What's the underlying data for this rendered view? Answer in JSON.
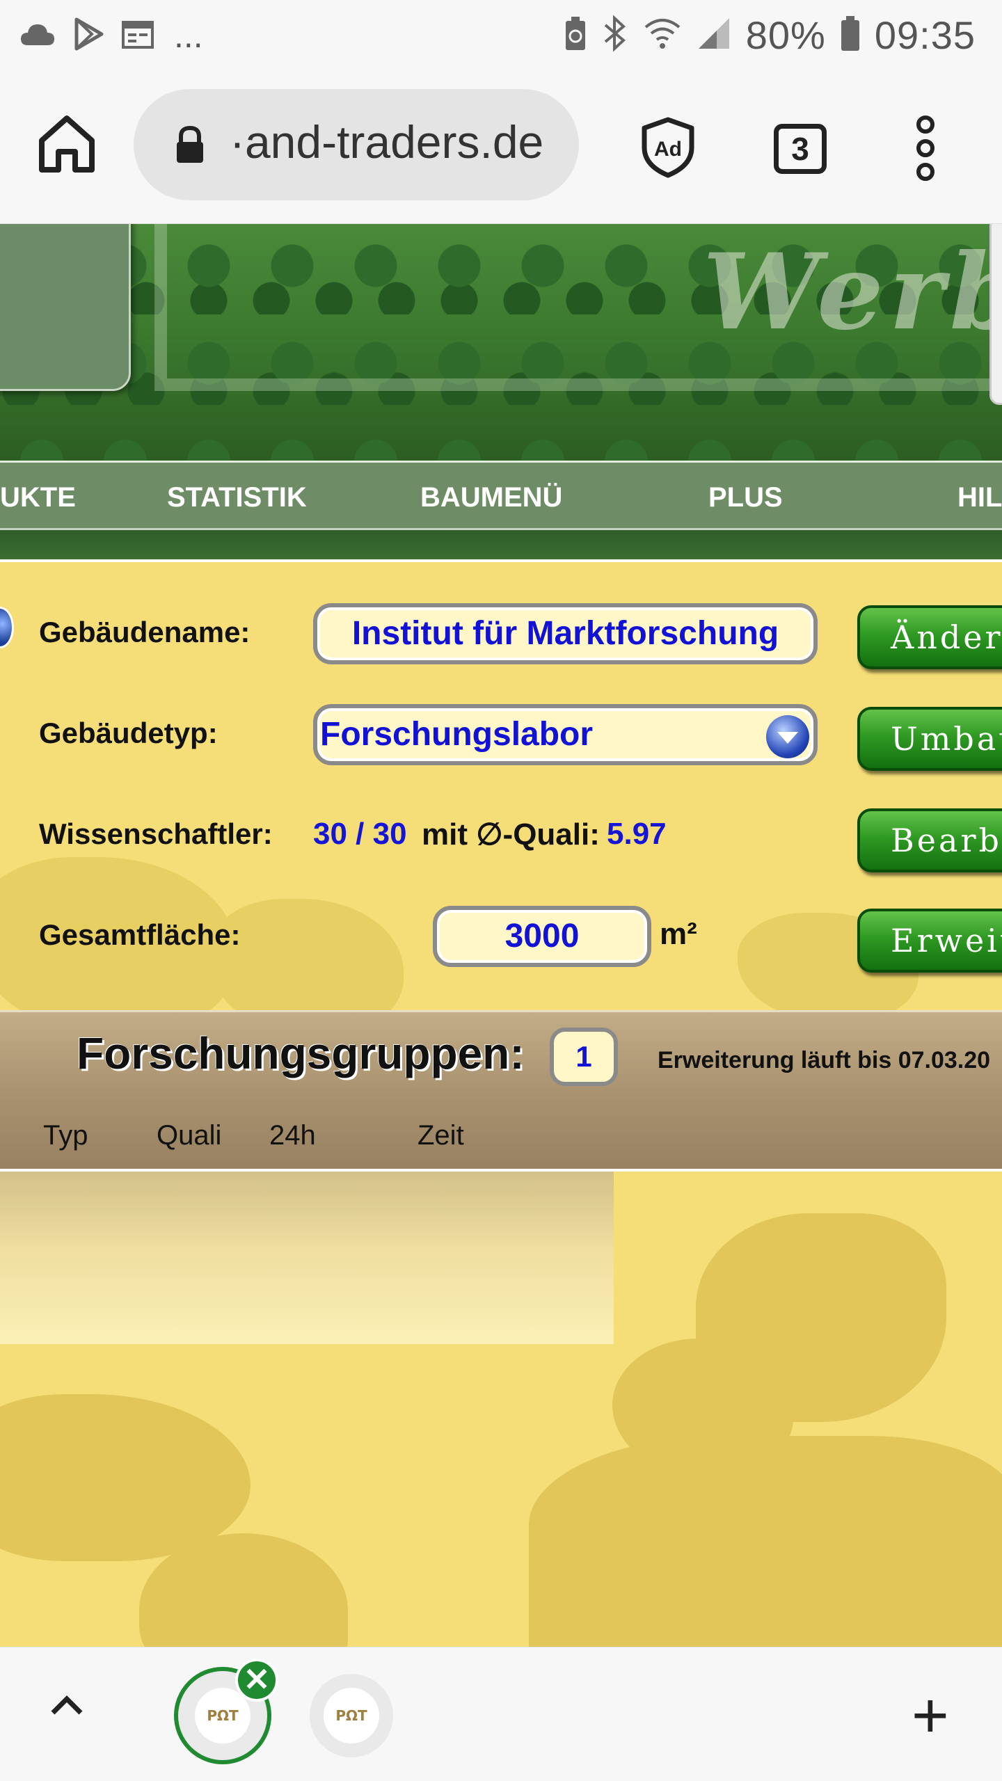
{
  "status_bar": {
    "battery": "80%",
    "time": "09:35",
    "more_notifications": "..."
  },
  "browser": {
    "url": "·and-traders.de",
    "tab_count": "3"
  },
  "banner": {
    "watermark": "Werb"
  },
  "nav": {
    "items": [
      "UKTE",
      "STATISTIK",
      "BAUMENÜ",
      "PLUS",
      "HIL"
    ]
  },
  "form": {
    "name_label": "Gebäudename:",
    "name_value": "Institut für Marktforschung",
    "type_label": "Gebäudetyp:",
    "type_value": "Forschungslabor",
    "scientists_label": "Wissenschaftler:",
    "scientists_value": "30 / 30",
    "scientists_mid": "mit ∅-Quali:",
    "scientists_quality": "5.97",
    "area_label": "Gesamtfläche:",
    "area_value": "3000",
    "area_unit": "m²",
    "buttons": {
      "change": "Ändern",
      "rebuild": "Umbau",
      "edit": "Bearbeiten",
      "extend": "Erweitern"
    }
  },
  "groups": {
    "title": "Forschungsgruppen:",
    "count": "1",
    "note": "Erweiterung läuft bis 07.03.20",
    "columns": [
      "Typ",
      "Quali",
      "24h",
      "Zeit"
    ]
  },
  "bottom_bar": {
    "favicon_text": "PΩT",
    "close_symbol": "✕",
    "new_tab_symbol": "+"
  }
}
